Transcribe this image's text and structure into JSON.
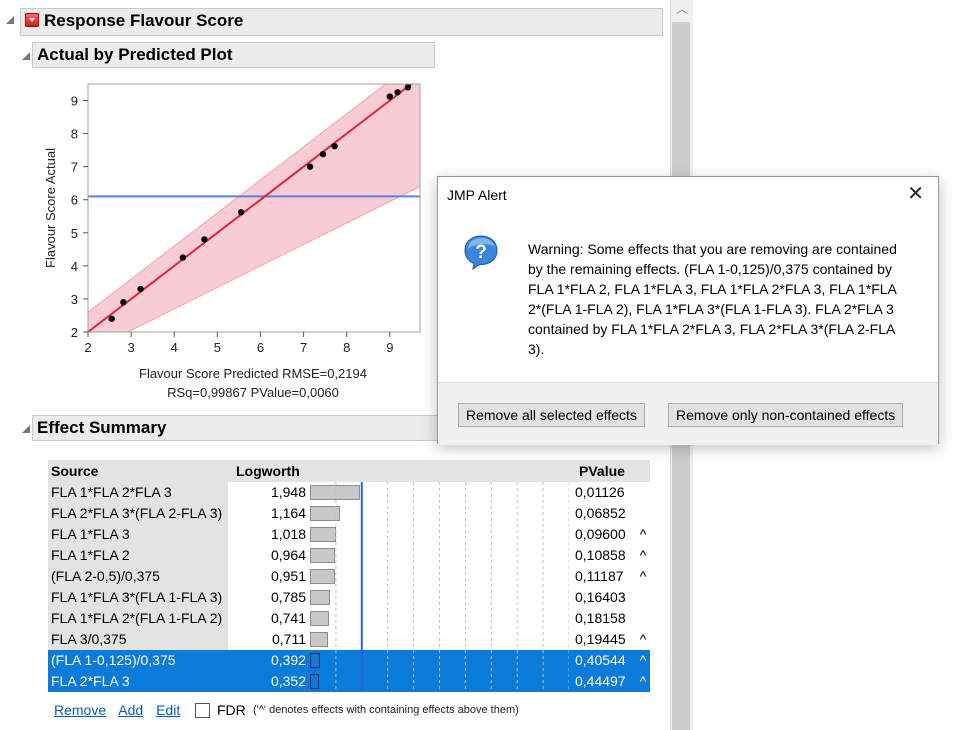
{
  "report": {
    "title": "Response Flavour Score",
    "actual_by_predicted": {
      "title": "Actual by Predicted Plot",
      "stats_line1": "Flavour Score Predicted RMSE=0,2194",
      "stats_line2": "RSq=0,99867 PValue=0,0060"
    },
    "effect_summary": {
      "title": "Effect Summary",
      "columns": [
        "Source",
        "Logworth",
        "PValue"
      ],
      "rows": [
        {
          "source": "FLA 1*FLA 2*FLA 3",
          "logworth": "1,948",
          "pvalue": "0,01126",
          "caret": "",
          "value": 1.948,
          "selected": false
        },
        {
          "source": "FLA 2*FLA 3*(FLA 2-FLA 3)",
          "logworth": "1,164",
          "pvalue": "0,06852",
          "caret": "",
          "value": 1.164,
          "selected": false
        },
        {
          "source": "FLA 1*FLA 3",
          "logworth": "1,018",
          "pvalue": "0,09600",
          "caret": "^",
          "value": 1.018,
          "selected": false
        },
        {
          "source": "FLA 1*FLA 2",
          "logworth": "0,964",
          "pvalue": "0,10858",
          "caret": "^",
          "value": 0.964,
          "selected": false
        },
        {
          "source": "(FLA 2-0,5)/0,375",
          "logworth": "0,951",
          "pvalue": "0,11187",
          "caret": "^",
          "value": 0.951,
          "selected": false
        },
        {
          "source": "FLA 1*FLA 3*(FLA 1-FLA 3)",
          "logworth": "0,785",
          "pvalue": "0,16403",
          "caret": "",
          "value": 0.785,
          "selected": false
        },
        {
          "source": "FLA 1*FLA 2*(FLA 1-FLA 2)",
          "logworth": "0,741",
          "pvalue": "0,18158",
          "caret": "",
          "value": 0.741,
          "selected": false
        },
        {
          "source": "FLA 3/0,375",
          "logworth": "0,711",
          "pvalue": "0,19445",
          "caret": "^",
          "value": 0.711,
          "selected": false
        },
        {
          "source": "(FLA 1-0,125)/0,375",
          "logworth": "0,392",
          "pvalue": "0,40544",
          "caret": "^",
          "value": 0.392,
          "selected": true
        },
        {
          "source": "FLA 2*FLA 3",
          "logworth": "0,352",
          "pvalue": "0,44497",
          "caret": "^",
          "value": 0.352,
          "selected": true
        }
      ],
      "logworth_bar_max": 10,
      "reference_logworth": 2,
      "links": {
        "remove": "Remove",
        "add": "Add",
        "edit": "Edit"
      },
      "fdr_label": "FDR",
      "note": "('^' denotes effects with containing effects above them)"
    }
  },
  "chart_data": {
    "type": "scatter",
    "title": "",
    "xlabel": "Flavour Score Predicted RMSE=0,2194",
    "ylabel": "Flavour Score Actual",
    "xlim": [
      2,
      9.7
    ],
    "ylim": [
      2,
      9.5
    ],
    "xticks": [
      "2",
      "3",
      "4",
      "5",
      "6",
      "7",
      "8",
      "9"
    ],
    "yticks": [
      "2",
      "3",
      "4",
      "5",
      "6",
      "7",
      "8",
      "9"
    ],
    "x": [
      2.55,
      2.82,
      3.22,
      4.2,
      4.7,
      5.55,
      7.15,
      7.45,
      7.72,
      9.0,
      9.18,
      9.42
    ],
    "y": [
      2.4,
      2.9,
      3.3,
      4.25,
      4.8,
      5.62,
      7.0,
      7.38,
      7.62,
      9.12,
      9.25,
      9.4
    ],
    "fit_line": [
      [
        2,
        2
      ],
      [
        9.7,
        9.7
      ]
    ],
    "mean_y": 6.1,
    "band_upper": [
      [
        2,
        2.6
      ],
      [
        9.7,
        10.3
      ]
    ],
    "band_lower": [
      [
        2,
        1.4
      ],
      [
        9.7,
        6.4
      ]
    ],
    "colors": {
      "points": "#000000",
      "fit": "#e0243a",
      "band": "#f8ccd4",
      "mean": "#5a7fe6"
    }
  },
  "dialog": {
    "title": "JMP Alert",
    "message": "Warning: Some effects that you are removing are contained by the remaining effects.  (FLA 1-0,125)/0,375 contained by FLA 1*FLA 2, FLA 1*FLA 3, FLA 1*FLA 2*FLA 3, FLA 1*FLA 2*(FLA 1-FLA 2), FLA 1*FLA 3*(FLA 1-FLA 3). FLA 2*FLA 3 contained by FLA 1*FLA 2*FLA 3, FLA 2*FLA 3*(FLA 2-FLA 3).",
    "button_remove_all": "Remove all selected effects",
    "button_remove_non_contained": "Remove only non-contained effects"
  }
}
